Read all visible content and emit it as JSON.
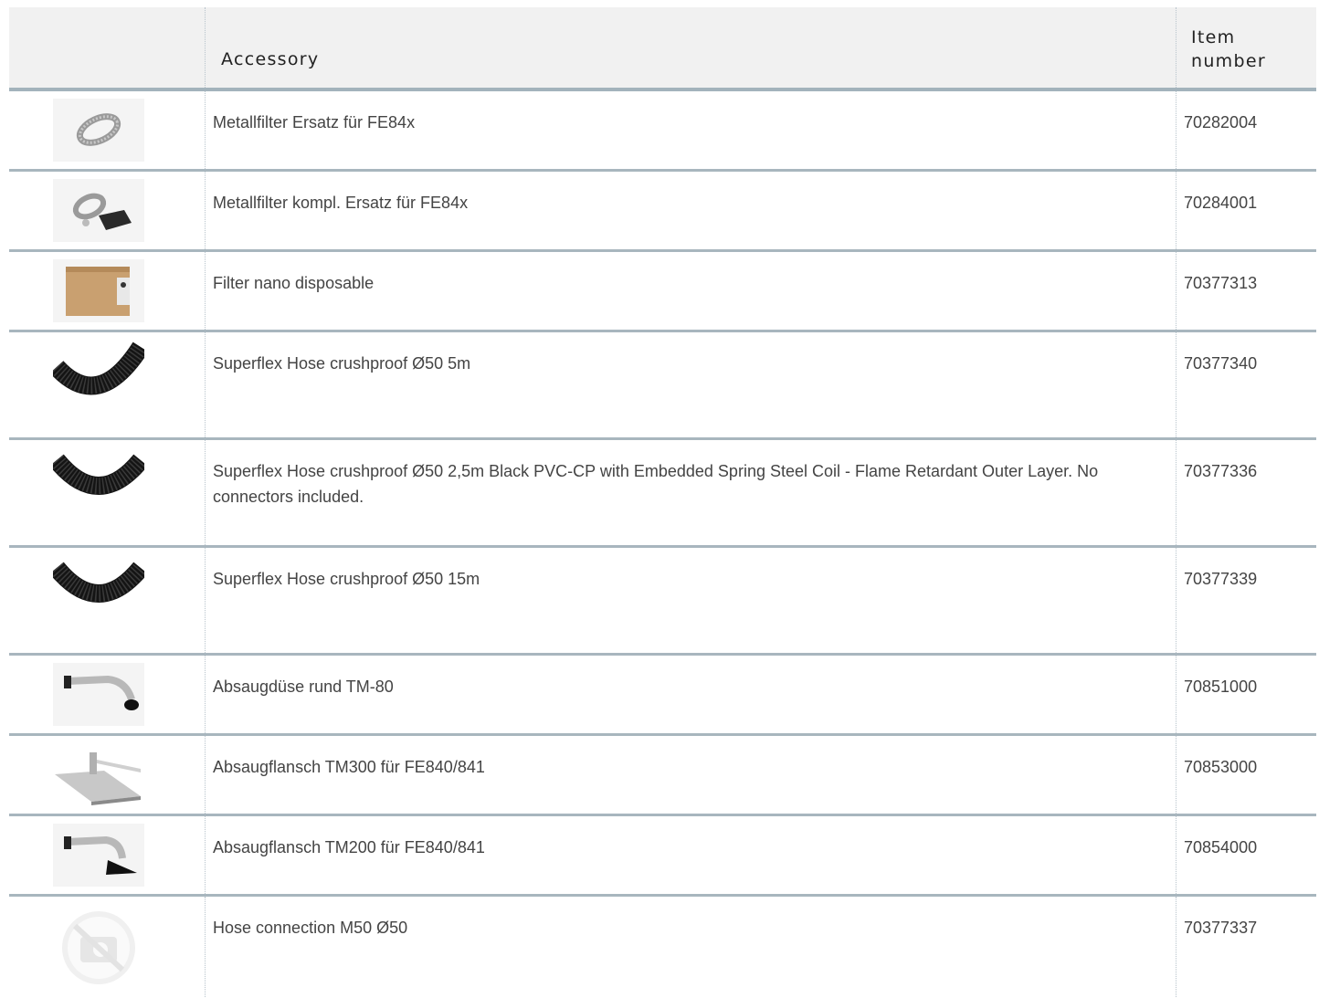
{
  "table": {
    "headers": {
      "image": "",
      "accessory": "Accessory",
      "item_number": "Item number"
    },
    "rows": [
      {
        "description": "Metallfilter Ersatz für FE84x",
        "item_number": "70282004",
        "image_icon": "metal-filter-icon"
      },
      {
        "description": "Metallfilter kompl. Ersatz für FE84x",
        "item_number": "70284001",
        "image_icon": "metal-filter-complete-icon"
      },
      {
        "description": "Filter nano disposable",
        "item_number": "70377313",
        "image_icon": "filter-box-icon"
      },
      {
        "description": "Superflex Hose crushproof Ø50 5m",
        "item_number": "70377340",
        "image_icon": "hose-icon"
      },
      {
        "description": "Superflex Hose crushproof Ø50 2,5m Black PVC-CP with Embedded Spring Steel Coil - Flame Retardant Outer Layer. No connectors included.",
        "item_number": "70377336",
        "image_icon": "hose-icon"
      },
      {
        "description": "Superflex Hose crushproof Ø50 15m",
        "item_number": "70377339",
        "image_icon": "hose-icon"
      },
      {
        "description": "Absaugdüse rund TM-80",
        "item_number": "70851000",
        "image_icon": "round-nozzle-icon"
      },
      {
        "description": "Absaugflansch TM300 für FE840/841",
        "item_number": "70853000",
        "image_icon": "flat-flange-icon"
      },
      {
        "description": "Absaugflansch TM200 für FE840/841",
        "item_number": "70854000",
        "image_icon": "flange-nozzle-icon"
      },
      {
        "description": "Hose connection M50 Ø50",
        "item_number": "70377337",
        "image_icon": "no-image-icon"
      }
    ]
  },
  "colors": {
    "header_bg": "#f1f1f1",
    "row_border": "#a8b6be",
    "text": "#444444"
  }
}
